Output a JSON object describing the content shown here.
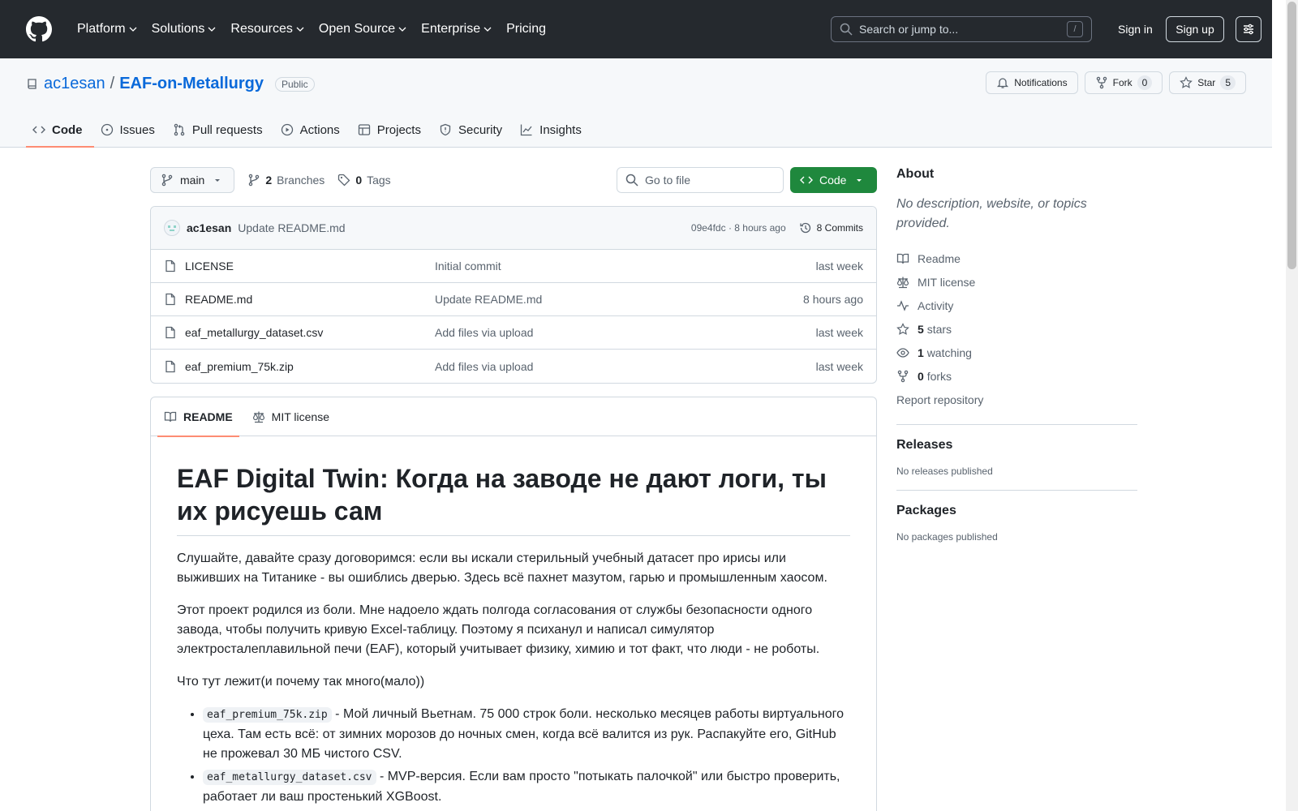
{
  "header": {
    "nav": [
      "Platform",
      "Solutions",
      "Resources",
      "Open Source",
      "Enterprise",
      "Pricing"
    ],
    "search_placeholder": "Search or jump to...",
    "search_key": "/",
    "sign_in": "Sign in",
    "sign_up": "Sign up"
  },
  "repo": {
    "owner": "ac1esan",
    "separator": "/",
    "name": "EAF-on-Metallurgy",
    "visibility": "Public",
    "notifications_label": "Notifications",
    "fork_label": "Fork",
    "fork_count": "0",
    "star_label": "Star",
    "star_count": "5",
    "tabs": [
      "Code",
      "Issues",
      "Pull requests",
      "Actions",
      "Projects",
      "Security",
      "Insights"
    ]
  },
  "toolbar": {
    "branch": "main",
    "branches_count": "2",
    "branches_label": "Branches",
    "tags_count": "0",
    "tags_label": "Tags",
    "goto_placeholder": "Go to file",
    "code_label": "Code"
  },
  "commit": {
    "author": "ac1esan",
    "message": "Update README.md",
    "hash_time": "09e4fdc · 8 hours ago",
    "commits_label": "8 Commits"
  },
  "files": [
    {
      "name": "LICENSE",
      "message": "Initial commit",
      "time": "last week"
    },
    {
      "name": "README.md",
      "message": "Update README.md",
      "time": "8 hours ago"
    },
    {
      "name": "eaf_metallurgy_dataset.csv",
      "message": "Add files via upload",
      "time": "last week"
    },
    {
      "name": "eaf_premium_75k.zip",
      "message": "Add files via upload",
      "time": "last week"
    }
  ],
  "readme": {
    "tab_readme": "README",
    "tab_license": "MIT license",
    "title": "EAF Digital Twin: Когда на заводе не дают логи, ты их рисуешь сам",
    "p1": "Слушайте, давайте сразу договоримся: если вы искали стерильный учебный датасет про ирисы или выживших на Титанике - вы ошиблись дверью. Здесь всё пахнет мазутом, гарью и промышленным хаосом.",
    "p2": "Этот проект родился из боли. Мне надоело ждать полгода согласования от службы безопасности одного завода, чтобы получить кривую Excel-таблицу. Поэтому я психанул и написал симулятор электросталеплавильной печи (EAF), который учитывает физику, химию и тот факт, что люди - не роботы.",
    "p3": "Что тут лежит(и почему так много(мало))",
    "li1_code": "eaf_premium_75k.zip",
    "li1_text": " - Мой личный Вьетнам. 75 000 строк боли. несколько месяцев работы виртуального цеха. Там есть всё: от зимних морозов до ночных смен, когда всё валится из рук. Распакуйте его, GitHub не прожевал 30 МБ чистого CSV.",
    "li2_code": "eaf_metallurgy_dataset.csv",
    "li2_text": " - MVP-версия. Если вам просто \"потыкать палочкой\" или быстро проверить, работает ли ваш простенький XGBoost."
  },
  "about": {
    "title": "About",
    "description": "No description, website, or topics provided.",
    "readme": "Readme",
    "license": "MIT license",
    "activity": "Activity",
    "stars_count": "5",
    "stars_label": "stars",
    "watching_count": "1",
    "watching_label": "watching",
    "forks_count": "0",
    "forks_label": "forks",
    "report": "Report repository"
  },
  "releases": {
    "title": "Releases",
    "note": "No releases published"
  },
  "packages": {
    "title": "Packages",
    "note": "No packages published"
  },
  "colors": {
    "header_bg": "#25292e",
    "link": "#0969da",
    "green": "#1f883d",
    "tab_underline": "#fd8c73"
  }
}
